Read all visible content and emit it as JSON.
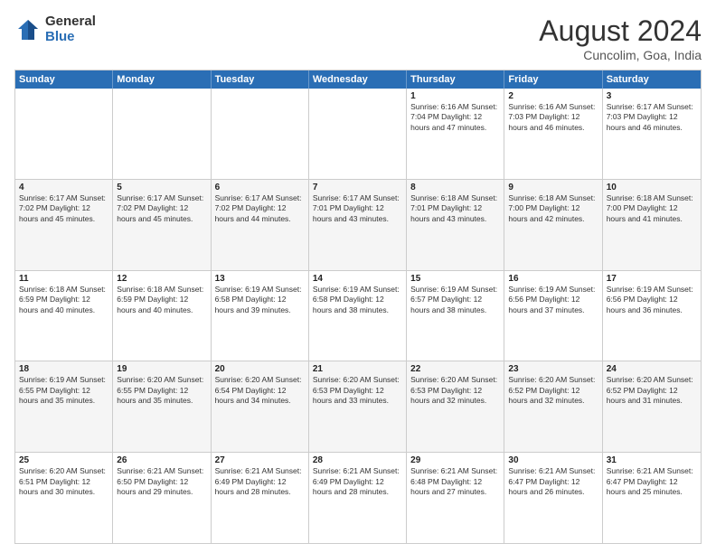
{
  "header": {
    "logo_general": "General",
    "logo_blue": "Blue",
    "month_year": "August 2024",
    "location": "Cuncolim, Goa, India"
  },
  "days_of_week": [
    "Sunday",
    "Monday",
    "Tuesday",
    "Wednesday",
    "Thursday",
    "Friday",
    "Saturday"
  ],
  "weeks": [
    [
      {
        "day": "",
        "info": ""
      },
      {
        "day": "",
        "info": ""
      },
      {
        "day": "",
        "info": ""
      },
      {
        "day": "",
        "info": ""
      },
      {
        "day": "1",
        "info": "Sunrise: 6:16 AM\nSunset: 7:04 PM\nDaylight: 12 hours\nand 47 minutes."
      },
      {
        "day": "2",
        "info": "Sunrise: 6:16 AM\nSunset: 7:03 PM\nDaylight: 12 hours\nand 46 minutes."
      },
      {
        "day": "3",
        "info": "Sunrise: 6:17 AM\nSunset: 7:03 PM\nDaylight: 12 hours\nand 46 minutes."
      }
    ],
    [
      {
        "day": "4",
        "info": "Sunrise: 6:17 AM\nSunset: 7:02 PM\nDaylight: 12 hours\nand 45 minutes."
      },
      {
        "day": "5",
        "info": "Sunrise: 6:17 AM\nSunset: 7:02 PM\nDaylight: 12 hours\nand 45 minutes."
      },
      {
        "day": "6",
        "info": "Sunrise: 6:17 AM\nSunset: 7:02 PM\nDaylight: 12 hours\nand 44 minutes."
      },
      {
        "day": "7",
        "info": "Sunrise: 6:17 AM\nSunset: 7:01 PM\nDaylight: 12 hours\nand 43 minutes."
      },
      {
        "day": "8",
        "info": "Sunrise: 6:18 AM\nSunset: 7:01 PM\nDaylight: 12 hours\nand 43 minutes."
      },
      {
        "day": "9",
        "info": "Sunrise: 6:18 AM\nSunset: 7:00 PM\nDaylight: 12 hours\nand 42 minutes."
      },
      {
        "day": "10",
        "info": "Sunrise: 6:18 AM\nSunset: 7:00 PM\nDaylight: 12 hours\nand 41 minutes."
      }
    ],
    [
      {
        "day": "11",
        "info": "Sunrise: 6:18 AM\nSunset: 6:59 PM\nDaylight: 12 hours\nand 40 minutes."
      },
      {
        "day": "12",
        "info": "Sunrise: 6:18 AM\nSunset: 6:59 PM\nDaylight: 12 hours\nand 40 minutes."
      },
      {
        "day": "13",
        "info": "Sunrise: 6:19 AM\nSunset: 6:58 PM\nDaylight: 12 hours\nand 39 minutes."
      },
      {
        "day": "14",
        "info": "Sunrise: 6:19 AM\nSunset: 6:58 PM\nDaylight: 12 hours\nand 38 minutes."
      },
      {
        "day": "15",
        "info": "Sunrise: 6:19 AM\nSunset: 6:57 PM\nDaylight: 12 hours\nand 38 minutes."
      },
      {
        "day": "16",
        "info": "Sunrise: 6:19 AM\nSunset: 6:56 PM\nDaylight: 12 hours\nand 37 minutes."
      },
      {
        "day": "17",
        "info": "Sunrise: 6:19 AM\nSunset: 6:56 PM\nDaylight: 12 hours\nand 36 minutes."
      }
    ],
    [
      {
        "day": "18",
        "info": "Sunrise: 6:19 AM\nSunset: 6:55 PM\nDaylight: 12 hours\nand 35 minutes."
      },
      {
        "day": "19",
        "info": "Sunrise: 6:20 AM\nSunset: 6:55 PM\nDaylight: 12 hours\nand 35 minutes."
      },
      {
        "day": "20",
        "info": "Sunrise: 6:20 AM\nSunset: 6:54 PM\nDaylight: 12 hours\nand 34 minutes."
      },
      {
        "day": "21",
        "info": "Sunrise: 6:20 AM\nSunset: 6:53 PM\nDaylight: 12 hours\nand 33 minutes."
      },
      {
        "day": "22",
        "info": "Sunrise: 6:20 AM\nSunset: 6:53 PM\nDaylight: 12 hours\nand 32 minutes."
      },
      {
        "day": "23",
        "info": "Sunrise: 6:20 AM\nSunset: 6:52 PM\nDaylight: 12 hours\nand 32 minutes."
      },
      {
        "day": "24",
        "info": "Sunrise: 6:20 AM\nSunset: 6:52 PM\nDaylight: 12 hours\nand 31 minutes."
      }
    ],
    [
      {
        "day": "25",
        "info": "Sunrise: 6:20 AM\nSunset: 6:51 PM\nDaylight: 12 hours\nand 30 minutes."
      },
      {
        "day": "26",
        "info": "Sunrise: 6:21 AM\nSunset: 6:50 PM\nDaylight: 12 hours\nand 29 minutes."
      },
      {
        "day": "27",
        "info": "Sunrise: 6:21 AM\nSunset: 6:49 PM\nDaylight: 12 hours\nand 28 minutes."
      },
      {
        "day": "28",
        "info": "Sunrise: 6:21 AM\nSunset: 6:49 PM\nDaylight: 12 hours\nand 28 minutes."
      },
      {
        "day": "29",
        "info": "Sunrise: 6:21 AM\nSunset: 6:48 PM\nDaylight: 12 hours\nand 27 minutes."
      },
      {
        "day": "30",
        "info": "Sunrise: 6:21 AM\nSunset: 6:47 PM\nDaylight: 12 hours\nand 26 minutes."
      },
      {
        "day": "31",
        "info": "Sunrise: 6:21 AM\nSunset: 6:47 PM\nDaylight: 12 hours\nand 25 minutes."
      }
    ]
  ]
}
